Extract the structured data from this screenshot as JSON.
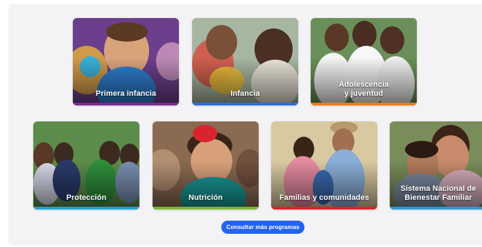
{
  "programs": [
    {
      "label": "Primera infancia",
      "bar_color": "#7b2d8e"
    },
    {
      "label": "Infancia",
      "bar_color": "#2f6fd6"
    },
    {
      "label_line1": "Adolescencia",
      "label_line2": "y juventud",
      "bar_color": "#f07c1a"
    },
    {
      "label": "Protección",
      "bar_color": "#1aa5d6"
    },
    {
      "label": "Nutrición",
      "bar_color": "#7cb82f"
    },
    {
      "label": "Familias y comunidades",
      "bar_color": "#d9262c"
    },
    {
      "label_line1": "Sistema Nacional de",
      "label_line2": "Bienestar Familiar",
      "bar_color": "#2a9bd6"
    }
  ],
  "more_button": {
    "label": "Consultar más programas",
    "color": "#2563eb"
  }
}
